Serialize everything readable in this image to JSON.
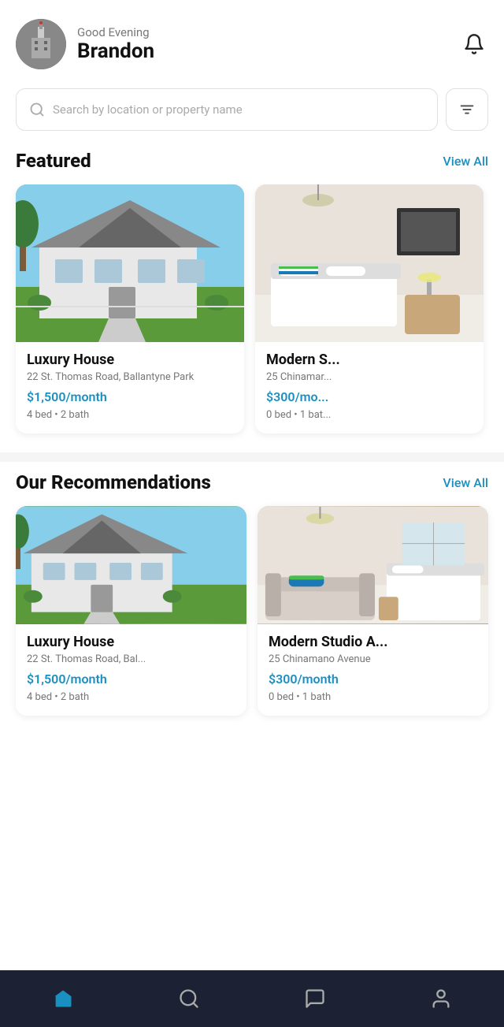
{
  "header": {
    "greeting_sub": "Good Evening",
    "greeting_name": "Brandon"
  },
  "search": {
    "placeholder": "Search by location or property name"
  },
  "featured": {
    "title": "Featured",
    "view_all": "View All",
    "properties": [
      {
        "title": "Luxury House",
        "address": "22 St. Thomas Road, Ballantyne Park",
        "price": "$1,500/month",
        "details": "4 bed • 2 bath",
        "image_type": "house"
      },
      {
        "title": "Modern S...",
        "address": "25 Chinamar...",
        "price": "$300/mo...",
        "details": "0 bed • 1 bat...",
        "image_type": "room"
      }
    ]
  },
  "recommendations": {
    "title": "Our Recommendations",
    "view_all": "View All",
    "properties": [
      {
        "title": "Luxury House",
        "address": "22 St. Thomas Road, Bal...",
        "price": "$1,500/month",
        "details": "4 bed • 2 bath",
        "image_type": "house"
      },
      {
        "title": "Modern Studio A...",
        "address": "25 Chinamano Avenue",
        "price": "$300/month",
        "details": "0 bed • 1 bath",
        "image_type": "room"
      }
    ]
  },
  "bottom_nav": {
    "items": [
      {
        "name": "home",
        "icon": "home-icon",
        "active": true
      },
      {
        "name": "search",
        "icon": "search-icon",
        "active": false
      },
      {
        "name": "messages",
        "icon": "message-icon",
        "active": false
      },
      {
        "name": "profile",
        "icon": "profile-icon",
        "active": false
      }
    ]
  }
}
